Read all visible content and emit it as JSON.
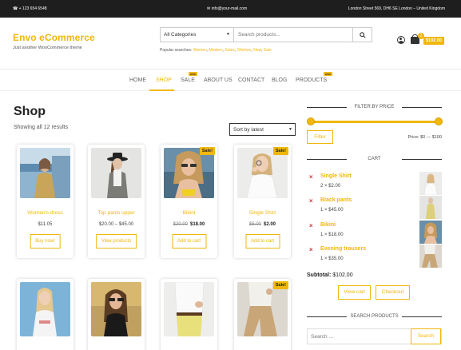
{
  "topbar": {
    "phone": "☎ + 123 654 6548",
    "email": "✉ info@your-mail.com",
    "address": "London Street 569, DH6 SE London – United Kingdom"
  },
  "brand": {
    "title": "Envo eCommerce",
    "tagline": "Just another WooCommerce theme"
  },
  "search": {
    "category": "All Categories",
    "placeholder": "Search products...",
    "popular_label": "Popular searches:",
    "popular_keywords": [
      "Women",
      "Modern",
      "Sales",
      "Stitches",
      "New",
      "Sale"
    ]
  },
  "header_cart": {
    "count": "2",
    "total": "$102.00"
  },
  "nav": {
    "home": "HOME",
    "shop": "SHOP",
    "sale": "SALE",
    "sale_badge": "new",
    "about": "ABOUT US",
    "contact": "CONTACT",
    "blog": "BLOG",
    "products": "PRODUCTS",
    "products_badge": "new"
  },
  "shop": {
    "title": "Shop",
    "results": "Showing all 12 results",
    "sort": "Sort by latest"
  },
  "products": [
    {
      "name": "Women's dress",
      "price": "$11.05",
      "old": "",
      "new": "",
      "button": "Buy now!",
      "sale": ""
    },
    {
      "name": "Top pants upper",
      "price": "$20.00 – $45.00",
      "old": "",
      "new": "",
      "button": "View products",
      "sale": ""
    },
    {
      "name": "Bikini",
      "price": "",
      "old": "$20.00",
      "new": "$18.00",
      "button": "Add to cart",
      "sale": "Sale!"
    },
    {
      "name": "Single Shirt",
      "price": "",
      "old": "$5.00",
      "new": "$2.00",
      "button": "Add to cart",
      "sale": "Sale!"
    }
  ],
  "products_row2": [
    {
      "name": "",
      "sale": ""
    },
    {
      "name": "",
      "sale": ""
    },
    {
      "name": "",
      "sale": ""
    },
    {
      "name": "",
      "sale": "Sale!"
    }
  ],
  "sidebar": {
    "filter_heading": "FILTER BY PRICE",
    "filter_button": "Filter",
    "price_label": "Price: $0 — $100",
    "cart_heading": "CART",
    "cart_items": [
      {
        "name": "Single Shirt",
        "qty": "2 × $2.00"
      },
      {
        "name": "Black pants",
        "qty": "1 × $45.00"
      },
      {
        "name": "Bikini",
        "qty": "1 × $18.00"
      },
      {
        "name": "Evening trousers",
        "qty": "1 × $35.00"
      }
    ],
    "subtotal_label": "Subtotal:",
    "subtotal_value": "$102.00",
    "view_cart": "View cart",
    "checkout": "Checkout",
    "search_heading": "SEARCH PRODUCTS",
    "search_placeholder": "Search ...",
    "search_button": "Search"
  },
  "colors": {
    "accent": "#f0b70c",
    "topbar": "#1e1e1e"
  }
}
